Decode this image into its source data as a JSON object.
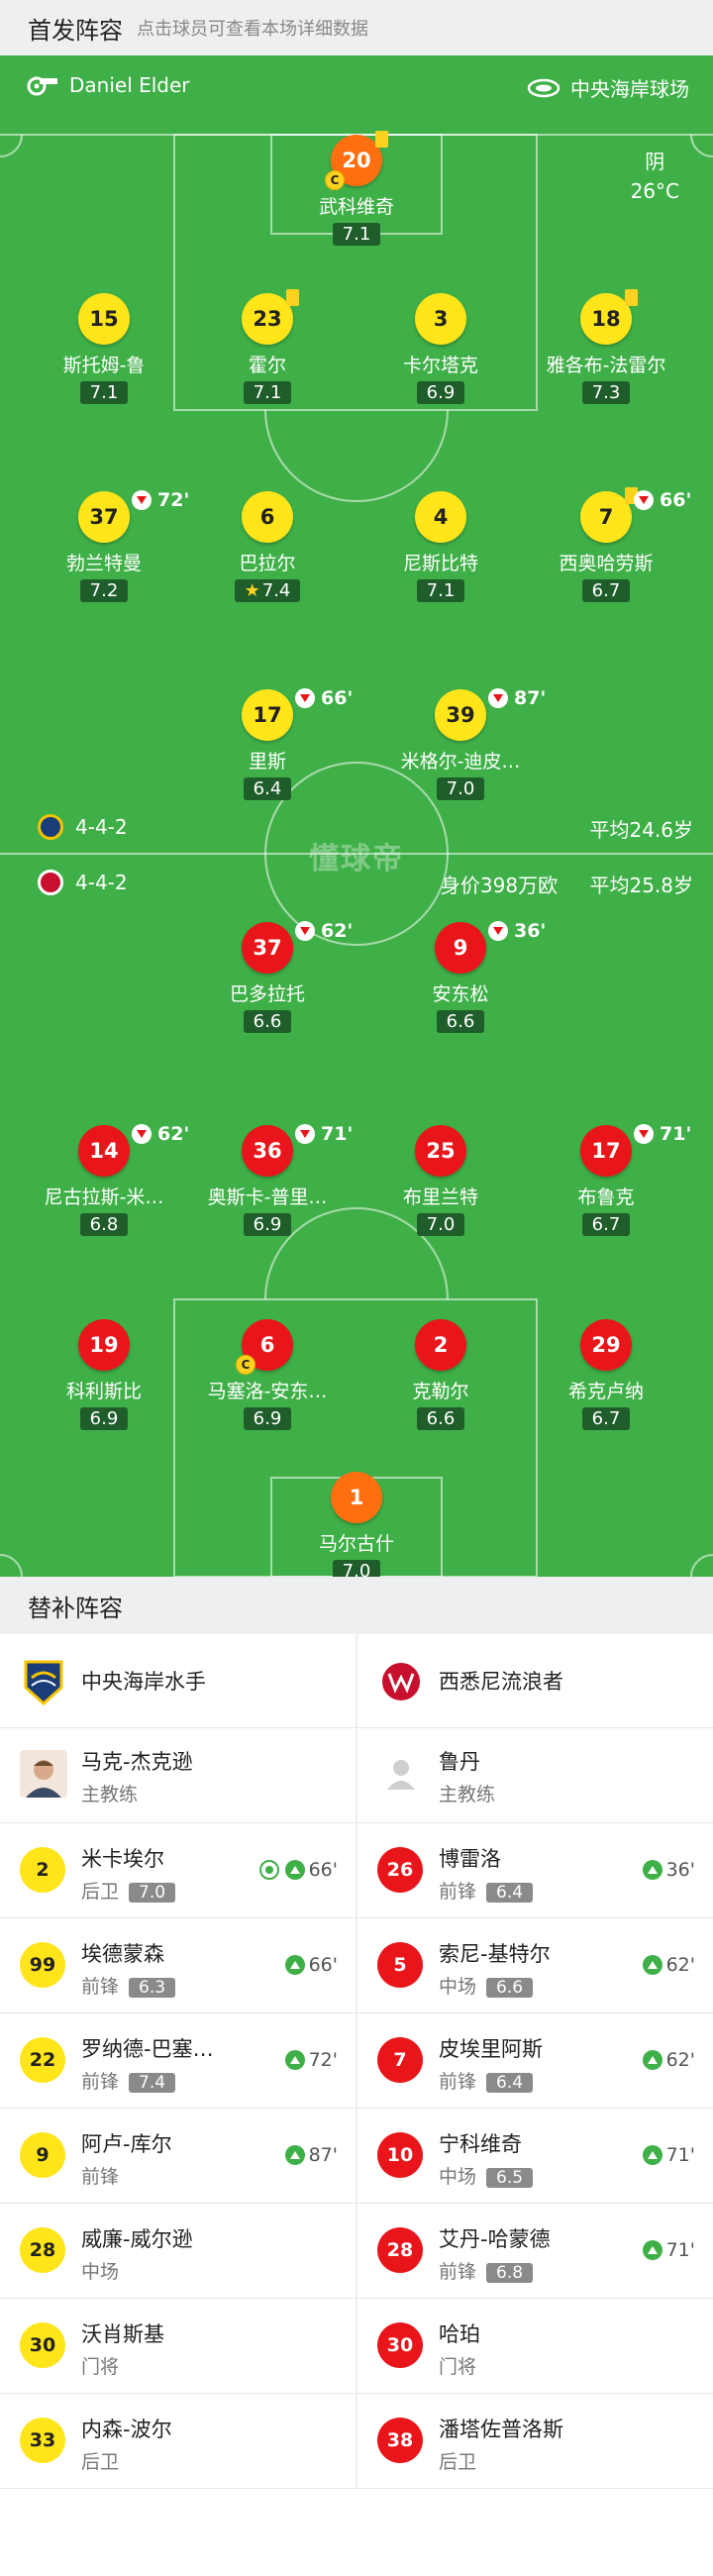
{
  "header": {
    "title": "首发阵容",
    "hint": "点击球员可查看本场详细数据"
  },
  "match_info": {
    "referee": "Daniel Elder",
    "venue": "中央海岸球场",
    "weather": "阴",
    "temperature": "26°C"
  },
  "home_team": {
    "name": "中央海岸水手",
    "formation": "4-4-2",
    "avg_age": "平均24.6岁"
  },
  "away_team": {
    "name": "西悉尼流浪者",
    "formation": "4-4-2",
    "market_value": "身价398万欧",
    "avg_age": "平均25.8岁"
  },
  "watermark": "懂球帝",
  "home_players": [
    {
      "number": "20",
      "name": "武科维奇",
      "rating": "7.1",
      "color": "#ff6f10",
      "captain": true,
      "yellow_card": true,
      "sub_out": ""
    },
    {
      "number": "15",
      "name": "斯托姆-鲁",
      "rating": "7.1",
      "color": "#ffe51a",
      "captain": false,
      "yellow_card": false,
      "sub_out": ""
    },
    {
      "number": "23",
      "name": "霍尔",
      "rating": "7.1",
      "color": "#ffe51a",
      "captain": false,
      "yellow_card": true,
      "sub_out": ""
    },
    {
      "number": "3",
      "name": "卡尔塔克",
      "rating": "6.9",
      "color": "#ffe51a",
      "captain": false,
      "yellow_card": false,
      "sub_out": ""
    },
    {
      "number": "18",
      "name": "雅各布-法雷尔",
      "rating": "7.3",
      "color": "#ffe51a",
      "captain": false,
      "yellow_card": true,
      "sub_out": ""
    },
    {
      "number": "37",
      "name": "勃兰特曼",
      "rating": "7.2",
      "color": "#ffe51a",
      "captain": false,
      "yellow_card": false,
      "sub_out": "72'"
    },
    {
      "number": "6",
      "name": "巴拉尔",
      "rating": "7.4",
      "color": "#ffe51a",
      "captain": false,
      "yellow_card": false,
      "sub_out": "",
      "star": true
    },
    {
      "number": "4",
      "name": "尼斯比特",
      "rating": "7.1",
      "color": "#ffe51a",
      "captain": false,
      "yellow_card": false,
      "sub_out": ""
    },
    {
      "number": "7",
      "name": "西奥哈劳斯",
      "rating": "6.7",
      "color": "#ffe51a",
      "captain": false,
      "yellow_card": true,
      "sub_out": "66'"
    },
    {
      "number": "17",
      "name": "里斯",
      "rating": "6.4",
      "color": "#ffe51a",
      "captain": false,
      "yellow_card": false,
      "sub_out": "66'"
    },
    {
      "number": "39",
      "name": "米格尔-迪皮…",
      "rating": "7.0",
      "color": "#ffe51a",
      "captain": false,
      "yellow_card": false,
      "sub_out": "87'"
    }
  ],
  "away_players": [
    {
      "number": "37",
      "name": "巴多拉托",
      "rating": "6.6",
      "color": "#e8161b",
      "captain": false,
      "sub_out": "62'"
    },
    {
      "number": "9",
      "name": "安东松",
      "rating": "6.6",
      "color": "#e8161b",
      "captain": false,
      "sub_out": "36'"
    },
    {
      "number": "14",
      "name": "尼古拉斯-米…",
      "rating": "6.8",
      "color": "#e8161b",
      "captain": false,
      "sub_out": "62'"
    },
    {
      "number": "36",
      "name": "奥斯卡-普里…",
      "rating": "6.9",
      "color": "#e8161b",
      "captain": false,
      "sub_out": "71'"
    },
    {
      "number": "25",
      "name": "布里兰特",
      "rating": "7.0",
      "color": "#e8161b",
      "captain": false,
      "sub_out": ""
    },
    {
      "number": "17",
      "name": "布鲁克",
      "rating": "6.7",
      "color": "#e8161b",
      "captain": false,
      "sub_out": "71'"
    },
    {
      "number": "19",
      "name": "科利斯比",
      "rating": "6.9",
      "color": "#e8161b",
      "captain": false,
      "sub_out": ""
    },
    {
      "number": "6",
      "name": "马塞洛-安东…",
      "rating": "6.9",
      "color": "#e8161b",
      "captain": true,
      "sub_out": ""
    },
    {
      "number": "2",
      "name": "克勒尔",
      "rating": "6.6",
      "color": "#e8161b",
      "captain": false,
      "sub_out": ""
    },
    {
      "number": "29",
      "name": "希克卢纳",
      "rating": "6.7",
      "color": "#e8161b",
      "captain": false,
      "sub_out": ""
    },
    {
      "number": "1",
      "name": "马尔古什",
      "rating": "7.0",
      "color": "#ff6f10",
      "captain": false,
      "sub_out": ""
    }
  ],
  "subs": {
    "title": "替补阵容",
    "home": {
      "team_name": "中央海岸水手",
      "coach": {
        "name": "马克-杰克逊",
        "role": "主教练"
      },
      "players": [
        {
          "number": "2",
          "name": "米卡埃尔",
          "pos": "后卫",
          "rating": "7.0",
          "sub_in": "66'",
          "goal": true
        },
        {
          "number": "99",
          "name": "埃德蒙森",
          "pos": "前锋",
          "rating": "6.3",
          "sub_in": "66'",
          "goal": false
        },
        {
          "number": "22",
          "name": "罗纳德-巴塞…",
          "pos": "前锋",
          "rating": "7.4",
          "sub_in": "72'",
          "goal": false
        },
        {
          "number": "9",
          "name": "阿卢-库尔",
          "pos": "前锋",
          "rating": "",
          "sub_in": "87'",
          "goal": false
        },
        {
          "number": "28",
          "name": "威廉-威尔逊",
          "pos": "中场",
          "rating": "",
          "sub_in": "",
          "goal": false
        },
        {
          "number": "30",
          "name": "沃肖斯基",
          "pos": "门将",
          "rating": "",
          "sub_in": "",
          "goal": false
        },
        {
          "number": "33",
          "name": "内森-波尔",
          "pos": "后卫",
          "rating": "",
          "sub_in": "",
          "goal": false
        }
      ]
    },
    "away": {
      "team_name": "西悉尼流浪者",
      "coach": {
        "name": "鲁丹",
        "role": "主教练"
      },
      "players": [
        {
          "number": "26",
          "name": "博雷洛",
          "pos": "前锋",
          "rating": "6.4",
          "sub_in": "36'"
        },
        {
          "number": "5",
          "name": "索尼-基特尔",
          "pos": "中场",
          "rating": "6.6",
          "sub_in": "62'"
        },
        {
          "number": "7",
          "name": "皮埃里阿斯",
          "pos": "前锋",
          "rating": "6.4",
          "sub_in": "62'"
        },
        {
          "number": "10",
          "name": "宁科维奇",
          "pos": "中场",
          "rating": "6.5",
          "sub_in": "71'"
        },
        {
          "number": "28",
          "name": "艾丹-哈蒙德",
          "pos": "前锋",
          "rating": "6.8",
          "sub_in": "71'"
        },
        {
          "number": "30",
          "name": "哈珀",
          "pos": "门将",
          "rating": "",
          "sub_in": ""
        },
        {
          "number": "38",
          "name": "潘塔佐普洛斯",
          "pos": "后卫",
          "rating": "",
          "sub_in": ""
        }
      ]
    }
  }
}
